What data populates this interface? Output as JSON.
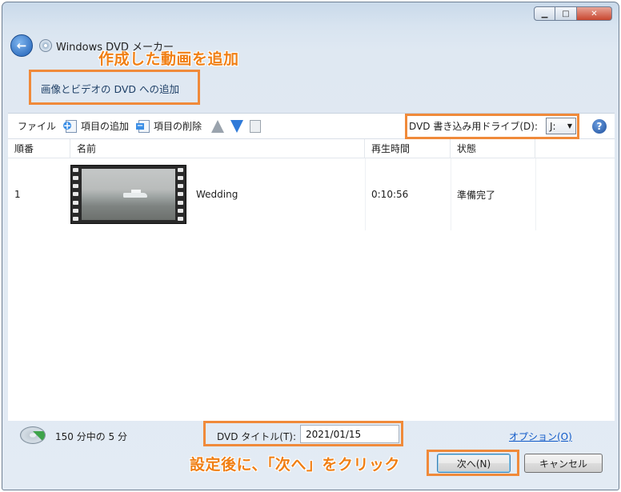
{
  "window": {
    "title": "Windows DVD メーカー"
  },
  "annotations": {
    "top": "作成した動画を追加",
    "bottom": "設定後に、「次へ」をクリック"
  },
  "subtitle": "画像とビデオの DVD への追加",
  "toolbar": {
    "file": "ファイル",
    "add_item": "項目の追加",
    "remove_item": "項目の削除",
    "drive_label": "DVD 書き込み用ドライブ(D):",
    "drive_value": "J:"
  },
  "table": {
    "headers": [
      "順番",
      "名前",
      "再生時間",
      "状態"
    ],
    "rows": [
      {
        "order": "1",
        "name": "Wedding",
        "duration": "0:10:56",
        "status": "準備完了"
      }
    ]
  },
  "footer": {
    "capacity": "150 分中の 5 分",
    "title_label": "DVD タイトル(T):",
    "title_value": "2021/01/15",
    "options": "オプション(O)",
    "next": "次へ(N)",
    "cancel": "キャンセル"
  }
}
